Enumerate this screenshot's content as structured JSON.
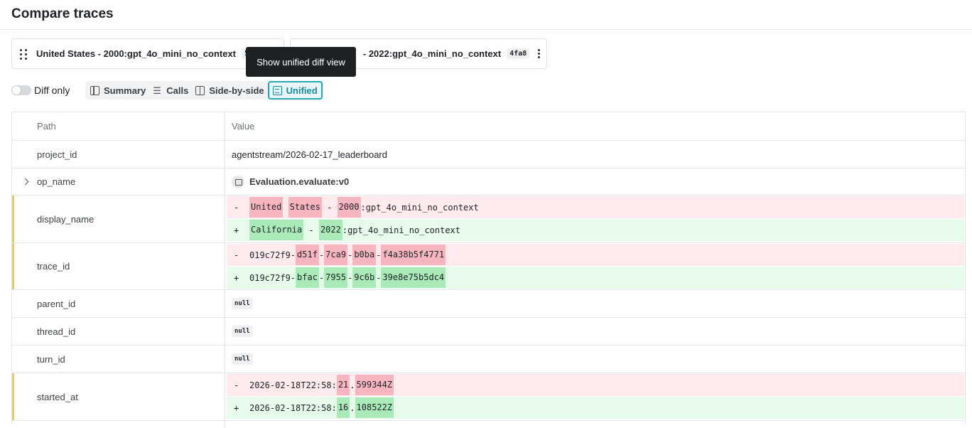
{
  "page": {
    "title": "Compare traces"
  },
  "traces": [
    {
      "name": "United States - 2000:gpt_4o_mini_no_context",
      "badge": "52"
    },
    {
      "name": "- 2022:gpt_4o_mini_no_context",
      "badge": "4fa8"
    }
  ],
  "tooltip": {
    "text": "Show unified diff view"
  },
  "toolbar": {
    "diff_only_label": "Diff only",
    "diff_only_on": false,
    "views": [
      {
        "label": "Summary",
        "icon": "table-icon"
      },
      {
        "label": "Calls",
        "icon": "layers-icon"
      },
      {
        "label": "Side-by-side",
        "icon": "book-icon"
      },
      {
        "label": "Unified",
        "icon": "unified-icon",
        "active": true
      }
    ]
  },
  "table": {
    "columns": [
      "Path",
      "Value"
    ],
    "rows": {
      "project_id": {
        "path": "project_id",
        "value": "agentstream/2026-02-17_leaderboard"
      },
      "op_name": {
        "path": "op_name",
        "value": "Evaluation.evaluate:v0"
      },
      "display_name": {
        "path": "display_name",
        "minus_sign": "-",
        "plus_sign": "+",
        "minus": [
          "United",
          " ",
          "States",
          " - ",
          "2000",
          ":gpt_4o_mini_no_context"
        ],
        "plus": [
          "California",
          " - ",
          "2022",
          ":gpt_4o_mini_no_context"
        ]
      },
      "trace_id": {
        "path": "trace_id",
        "minus_sign": "-",
        "plus_sign": "+",
        "minus": [
          "019c72f9-",
          "d51f",
          "-",
          "7ca9",
          "-",
          "b0ba",
          "-",
          "f4a38b5f4771"
        ],
        "plus": [
          "019c72f9-",
          "bfac",
          "-",
          "7955",
          "-",
          "9c6b",
          "-",
          "39e8e75b5dc4"
        ]
      },
      "parent_id": {
        "path": "parent_id",
        "value": "null"
      },
      "thread_id": {
        "path": "thread_id",
        "value": "null"
      },
      "turn_id": {
        "path": "turn_id",
        "value": "null"
      },
      "started_at": {
        "path": "started_at",
        "minus_sign": "-",
        "plus_sign": "+",
        "minus": [
          "2026-02-18T22:58:",
          "21",
          ".",
          "599344Z"
        ],
        "plus": [
          "2026-02-18T22:58:",
          "16",
          ".",
          "108522Z"
        ]
      }
    }
  },
  "colors": {
    "accent": "#28a6b8",
    "changed_marker": "#f5c84c",
    "removed_bg": "#ffebee",
    "removed_highlight": "#f7b5bf",
    "added_bg": "#e6fbe9",
    "added_highlight": "#a9eab8"
  }
}
